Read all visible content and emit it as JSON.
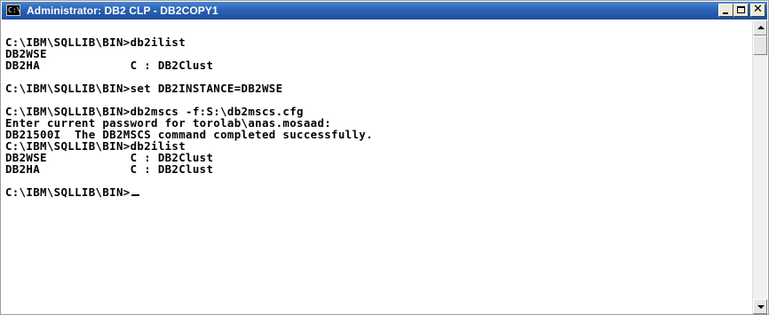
{
  "window": {
    "title": "Administrator: DB2 CLP - DB2COPY1",
    "icon": "console-icon",
    "icon_label": "C:\\",
    "accent_color": "#2a62b4",
    "controls": {
      "minimize": "minimize-icon",
      "maximize": "maximize-icon",
      "close": "close-icon",
      "close_glyph": "✕"
    }
  },
  "console": {
    "lines": [
      "",
      "C:\\IBM\\SQLLIB\\BIN>db2ilist",
      "DB2WSE",
      "DB2HA             C : DB2Clust",
      "",
      "C:\\IBM\\SQLLIB\\BIN>set DB2INSTANCE=DB2WSE",
      "",
      "C:\\IBM\\SQLLIB\\BIN>db2mscs -f:S:\\db2mscs.cfg",
      "Enter current password for torolab\\anas.mosaad:",
      "DB21500I  The DB2MSCS command completed successfully.",
      "C:\\IBM\\SQLLIB\\BIN>db2ilist",
      "DB2WSE            C : DB2Clust",
      "DB2HA             C : DB2Clust",
      "",
      "C:\\IBM\\SQLLIB\\BIN>"
    ],
    "cursor": "_"
  }
}
